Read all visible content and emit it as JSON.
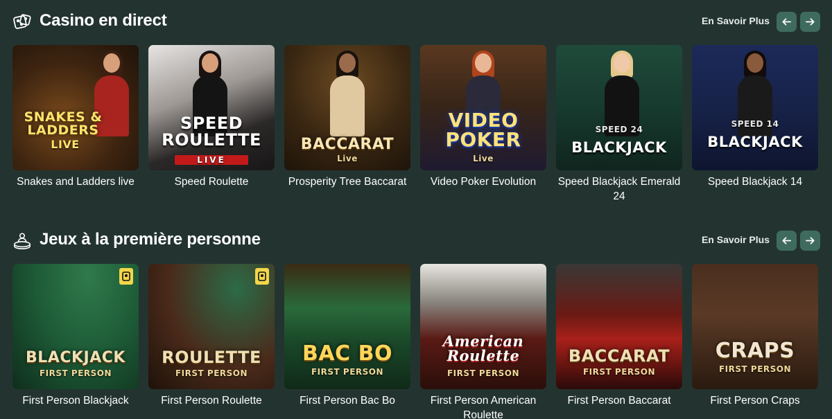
{
  "sections": [
    {
      "title": "Casino en direct",
      "icon": "dice-icon",
      "more_label": "En Savoir Plus",
      "games": [
        {
          "name": "Snakes and Ladders live",
          "art_title": "SNAKES & LADDERS",
          "art_sub": "LIVE"
        },
        {
          "name": "Speed Roulette",
          "art_title": "SPEED ROULETTE",
          "art_sub": "LIVE"
        },
        {
          "name": "Prosperity Tree Baccarat",
          "art_title": "BACCARAT",
          "art_sub": "Live"
        },
        {
          "name": "Video Poker Evolution",
          "art_title": "VIDEO POKER",
          "art_sub": "Live"
        },
        {
          "name": "Speed Blackjack Emerald 24",
          "art_title": "BLACKJACK",
          "art_sub": "SPEED 24"
        },
        {
          "name": "Speed Blackjack 14",
          "art_title": "BLACKJACK",
          "art_sub": "SPEED 14"
        }
      ]
    },
    {
      "title": "Jeux à la première personne",
      "icon": "dealer-icon",
      "more_label": "En Savoir Plus",
      "games": [
        {
          "name": "First Person Blackjack",
          "art_title": "BLACKJACK",
          "art_sub": "FIRST PERSON"
        },
        {
          "name": "First Person Roulette",
          "art_title": "ROULETTE",
          "art_sub": "FIRST PERSON"
        },
        {
          "name": "First Person Bac Bo",
          "art_title": "BAC BO",
          "art_sub": "FIRST PERSON"
        },
        {
          "name": "First Person American Roulette",
          "art_title": "American Roulette",
          "art_sub": "FIRST PERSON"
        },
        {
          "name": "First Person Baccarat",
          "art_title": "BACCARAT",
          "art_sub": "FIRST PERSON"
        },
        {
          "name": "First Person Craps",
          "art_title": "CRAPS",
          "art_sub": "FIRST PERSON"
        }
      ]
    }
  ],
  "colors": {
    "background": "#233430",
    "nav_button": "#3f6b5e",
    "badge": "#f2d64a"
  }
}
